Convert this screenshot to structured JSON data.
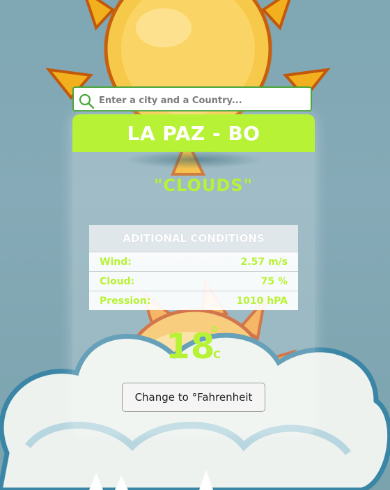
{
  "search": {
    "placeholder": "Enter a city and a Country..."
  },
  "location": {
    "title": "LA PAZ - BO"
  },
  "weather": {
    "description": "\"CLOUDS\""
  },
  "conditions": {
    "header": "ADITIONAL CONDITIONS",
    "rows": [
      {
        "label": "Wind:",
        "value": "2.57 m/s"
      },
      {
        "label": "Cloud:",
        "value": "75 %"
      },
      {
        "label": "Pression:",
        "value": "1010 hPA"
      }
    ]
  },
  "temperature": {
    "value": "18",
    "degree": "°",
    "unit": "C"
  },
  "toggle": {
    "label": "Change to °Fahrenheit"
  },
  "icons": {
    "search": "search-icon",
    "sun": "sun-icon",
    "cloud": "cloud-icon"
  },
  "colors": {
    "accent": "#b8f236",
    "search_border": "#4aa63a",
    "background": "#84a8b5"
  }
}
